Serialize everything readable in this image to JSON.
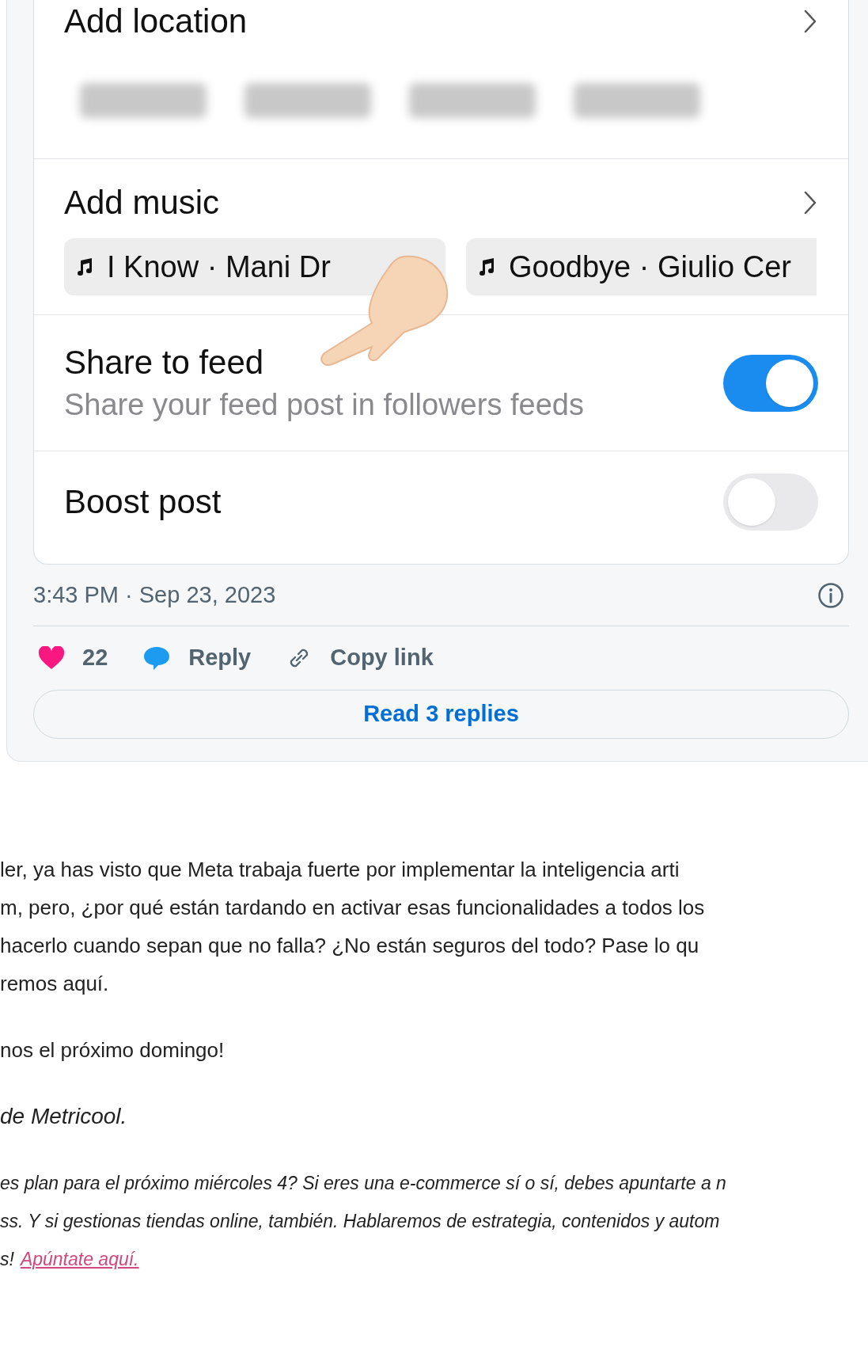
{
  "post_settings": {
    "rows": [
      {
        "kind": "nav",
        "label": "Add location",
        "chips": [
          {
            "kind": "blurred"
          },
          {
            "kind": "blurred"
          },
          {
            "kind": "blurred"
          },
          {
            "kind": "blurred"
          }
        ]
      },
      {
        "kind": "nav",
        "label": "Add music",
        "chips": [
          {
            "kind": "song",
            "title": "I Know · Mani Dr"
          },
          {
            "kind": "song",
            "title": "Goodbye · Giulio Cer"
          }
        ]
      },
      {
        "kind": "toggle",
        "label": "Share to feed",
        "subtitle": "Share your feed post in followers feeds",
        "on": true
      },
      {
        "kind": "toggle",
        "label": "Boost post",
        "on": false
      }
    ]
  },
  "timestamp": "3:43 PM · Sep 23, 2023",
  "actions": [
    {
      "kind": "like",
      "label": "22"
    },
    {
      "kind": "reply",
      "label": "Reply"
    },
    {
      "kind": "copy",
      "label": "Copy link"
    }
  ],
  "read_replies": "Read 3 replies",
  "article": {
    "paragraphs": [
      {
        "kind": "body",
        "lines": [
          "ler, ya has visto que Meta trabaja fuerte por implementar la inteligencia arti",
          "m, pero, ¿por qué están tardando en activar esas funcionalidades a todos los",
          "hacerlo cuando sepan que no falla? ¿No están seguros del todo? Pase lo qu",
          "remos aquí."
        ]
      },
      {
        "kind": "body",
        "lines": [
          "nos el próximo domingo!"
        ]
      },
      {
        "kind": "signature",
        "lines": [
          "de Metricool."
        ]
      },
      {
        "kind": "promo",
        "lines": [
          "es plan para el próximo miércoles 4? Si eres una e-commerce sí o sí, debes apuntarte a n",
          "ss. Y si gestionas tiendas online, también. Hablaremos de estrategia, contenidos y autom",
          "s!"
        ],
        "link": "Apúntate aquí."
      }
    ]
  }
}
